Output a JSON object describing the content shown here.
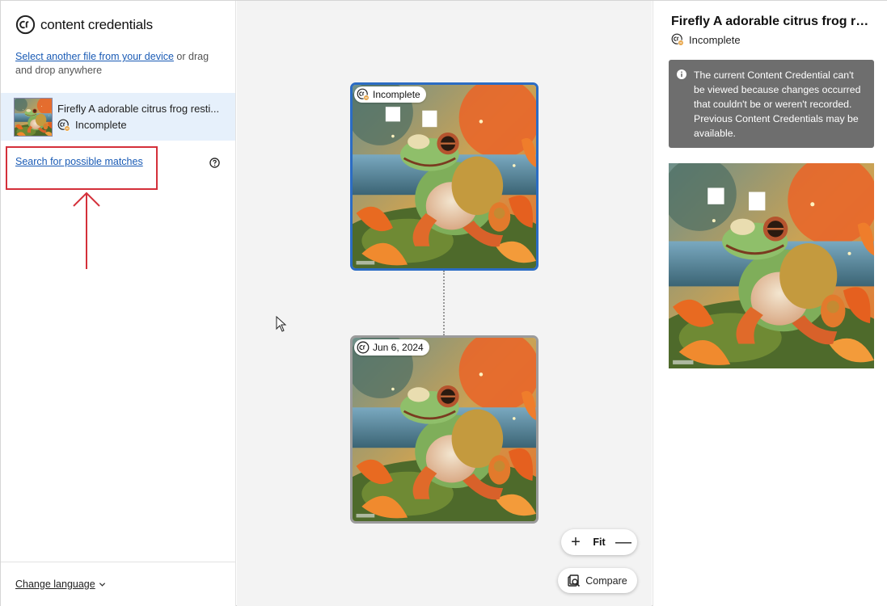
{
  "brand": {
    "name": "content credentials"
  },
  "sidebar": {
    "upload_link": "Select another file from your device",
    "upload_rest": " or drag and drop anywhere",
    "file": {
      "name": "Firefly A adorable citrus frog resti...",
      "status": "Incomplete"
    },
    "search_link": "Search for possible matches",
    "footer": {
      "change_language": "Change language"
    }
  },
  "canvas": {
    "nodes": [
      {
        "label": "Incomplete"
      },
      {
        "label": "Jun 6, 2024"
      }
    ],
    "zoom": {
      "plus": "+",
      "fit": "Fit",
      "minus": "—"
    },
    "compare": "Compare"
  },
  "panel": {
    "title": "Firefly A adorable citrus frog re...",
    "status": "Incomplete",
    "notice": "The current Content Credential can't be viewed because changes occurred that couldn't be or weren't recorded. Previous Content Credentials may be available."
  },
  "colors": {
    "accent": "#1a5bb5",
    "selected_border": "#2b6cc4",
    "highlight_box": "#d4303a",
    "notice_bg": "#6e6e6e",
    "active_row": "#e6f0fb"
  }
}
